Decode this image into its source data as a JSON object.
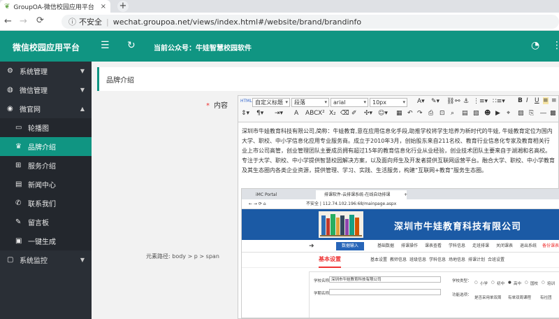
{
  "browser": {
    "tab_title": "GroupOA-微信校园应用平台",
    "tab_close": "×",
    "new_tab": "+",
    "back": "←",
    "forward": "→",
    "reload": "C",
    "security_label": "不安全",
    "url": "wechat.groupoa.net/views/index.html#/website/brand/brandinfo"
  },
  "header": {
    "app_title": "微信校园应用平台",
    "current_account_label": "当前公众号：牛娃智慧校园软件"
  },
  "sidebar": {
    "items": [
      {
        "label": "系统管理",
        "icon": "gear-icon",
        "expanded": false
      },
      {
        "label": "微信管理",
        "icon": "wechat-icon",
        "expanded": false
      },
      {
        "label": "微官网",
        "icon": "globe-icon",
        "expanded": true,
        "children": [
          {
            "label": "轮播图",
            "icon": "slideshow-icon"
          },
          {
            "label": "品牌介绍",
            "icon": "crown-icon",
            "active": true
          },
          {
            "label": "服务介绍",
            "icon": "grid-icon"
          },
          {
            "label": "新闻中心",
            "icon": "news-icon"
          },
          {
            "label": "联系我们",
            "icon": "phone-icon"
          },
          {
            "label": "留言板",
            "icon": "pencil-icon"
          },
          {
            "label": "一键生成",
            "icon": "box-icon"
          }
        ]
      },
      {
        "label": "系统监控",
        "icon": "monitor-icon",
        "expanded": false
      }
    ]
  },
  "page": {
    "section_title": "品牌介绍",
    "field_label": "内容",
    "required_mark": "*"
  },
  "editor": {
    "html_label": "HTML",
    "custom_title": "自定义标题",
    "paragraph": "段落",
    "font": "arial",
    "size": "10px",
    "content_text": "深圳市牛娃教育科技有限公司,简称：牛娃教育,意在应用信息化手段,助推学校将学生培养为新时代的牛娃, 牛娃教育定位为国内大学、职校、中小学信息化应用专业服务商。成立于2010年3月，创始股东来自211名校、教育行业信息化专家及教育相关行业上市公司高管，创业管理团队主要成员拥有超过15年的教育信息化行业从业经验，创业技术团队主要来自于湖湘和名高校。专注于大学、职校、中小学提供智慧校园解决方案，以及面向师生及开发者提供互联网运营平台。融合大学、职校、中小学教育及其生态圈内各类企业资源，提供管理、学习、实践、生活服务，构建“互联网+教育”服务生态圈。",
    "status_path": "元素路径: body > p > span"
  },
  "embedded": {
    "tab1": "iMC Portal",
    "tab2": "排课软件-云排课系统-在线自动排课",
    "new_tab": "+",
    "security_label": "不安全",
    "url": "112.74.102.196:68/mainpage.aspx",
    "company_name": "深圳市牛娃教育科技有限公司",
    "data_entry_btn": "数据输入",
    "nav_items": [
      "基础数据",
      "排课操作",
      "课表查看",
      "学科信息",
      "走班排课",
      "关闭课表",
      "退出系统"
    ],
    "backup_label": "备份课表",
    "tabs_row": [
      "基本设置"
    ],
    "sub_tabs": [
      "基本设置",
      "教师信息",
      "班级信息",
      "学科信息",
      "场地信息",
      "排课计划",
      "合班设置"
    ],
    "form": {
      "school_name_label": "学校名称：",
      "school_name_value": "深圳市牛娃教育科技有限公司",
      "school_id_label": "学期名称：",
      "school_type_label": "学校类型：",
      "school_types": [
        "小学",
        "初中",
        "高中",
        "国校",
        "培训"
      ],
      "func_label": "功能选项：",
      "func_opt1": "是否采用单双周",
      "func_opt2": "有单双周课程",
      "func_opt3": "有社团"
    }
  }
}
